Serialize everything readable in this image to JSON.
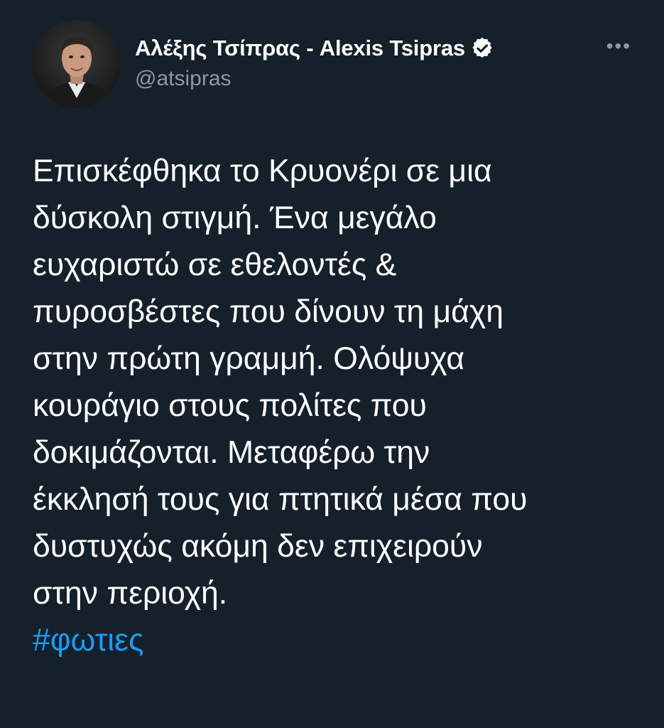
{
  "author": {
    "display_name": "Αλέξης Τσίπρας - Alexis Tsipras",
    "handle": "@atsipras",
    "verified": true,
    "avatar": "profile-photo"
  },
  "menu": {
    "icon": "more-icon",
    "label": "•••"
  },
  "tweet": {
    "lines": [
      "Επισκέφθηκα το Κρυονέρι σε μια",
      "δύσκολη στιγμή. Ένα μεγάλο",
      "ευχαριστώ σε εθελοντές &",
      "πυροσβέστες που δίνουν τη μάχη",
      "στην πρώτη γραμμή. Ολόψυχα",
      "κουράγιο στους πολίτες που",
      "δοκιμάζονται. Μεταφέρω την",
      "έκκλησή τους για πτητικά μέσα που",
      "δυστυχώς ακόμη δεν επιχειρούν",
      "στην περιοχή."
    ],
    "hashtag": "#φωτιες"
  },
  "colors": {
    "background": "#15202b",
    "text": "#ffffff",
    "secondary": "#8b98a5",
    "link": "#1d9bf0"
  }
}
